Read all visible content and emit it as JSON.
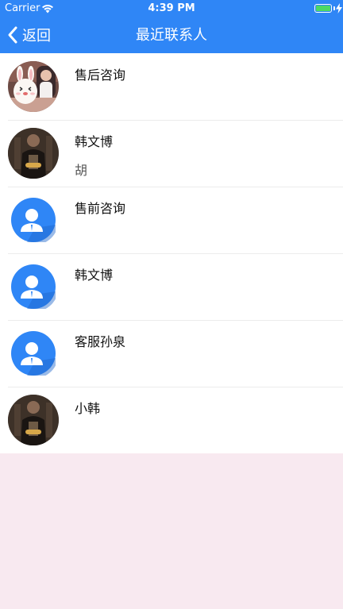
{
  "status_bar": {
    "carrier": "Carrier",
    "time": "4:39 PM",
    "battery_level": 1.0,
    "wifi_icon": "wifi-icon",
    "charging_icon": "lightning-bolt-icon"
  },
  "nav": {
    "back_label": "返回",
    "back_icon": "chevron-left-icon",
    "title": "最近联系人"
  },
  "colors": {
    "nav_background": "#2f86f6",
    "page_background": "#f8e9f0",
    "list_background": "#ffffff",
    "divider": "#ececec",
    "default_avatar": "#2f86f6"
  },
  "contacts": [
    {
      "name": "售后咨询",
      "last_message": "",
      "avatar": "photo-avatar-cartoon"
    },
    {
      "name": "韩文博",
      "last_message": "胡",
      "avatar": "photo-avatar-person"
    },
    {
      "name": "售前咨询",
      "last_message": "",
      "avatar": "default-user-icon"
    },
    {
      "name": "韩文博",
      "last_message": "",
      "avatar": "default-user-icon"
    },
    {
      "name": "客服孙泉",
      "last_message": "",
      "avatar": "default-user-icon"
    },
    {
      "name": "小韩",
      "last_message": "",
      "avatar": "photo-avatar-person"
    }
  ]
}
